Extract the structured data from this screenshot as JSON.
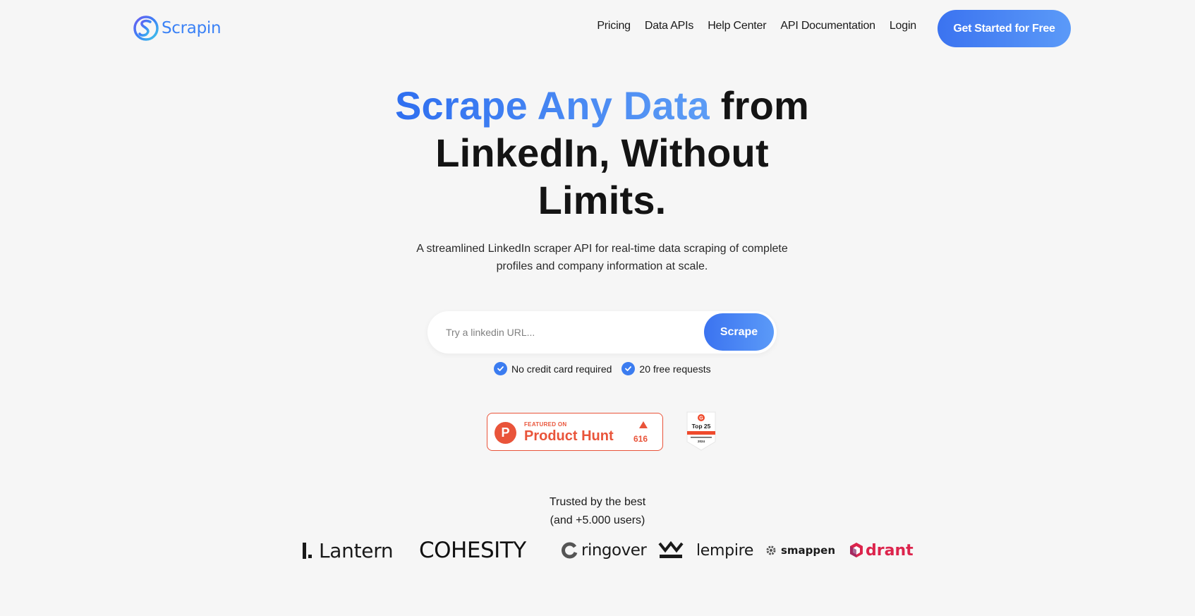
{
  "header": {
    "logo_text": "Scrapin",
    "nav": [
      "Pricing",
      "Data APIs",
      "Help Center",
      "API Documentation",
      "Login"
    ],
    "cta_label": "Get Started for Free"
  },
  "hero": {
    "title_accent": "Scrape Any Data",
    "title_rest_1": "from",
    "title_rest_2": "LinkedIn, Without",
    "title_rest_3": "Limits.",
    "subtitle_line1": "A streamlined LinkedIn scraper API for real-time data scraping of complete",
    "subtitle_line2": "profiles and company information at scale."
  },
  "search": {
    "placeholder": "Try a linkedin URL...",
    "value": "",
    "button_label": "Scrape"
  },
  "checks": [
    "No credit card required",
    "20 free requests"
  ],
  "badges": {
    "product_hunt_small": "FEATURED ON",
    "product_hunt_big": "Product Hunt",
    "product_hunt_count": "616",
    "g2_text": "Top 25",
    "g2_year": "2024"
  },
  "trusted": {
    "line1": "Trusted by the best",
    "line2": "(and +5.000 users)"
  },
  "logos": {
    "lantern": "Lantern",
    "cohesity": "COHESITY",
    "ringover": "ringover",
    "lempire": "lempire",
    "smappen": "smappen",
    "qdrant": "drant"
  },
  "colors": {
    "accent": "#3b82f6",
    "product_hunt": "#e9543a",
    "background": "#f6f6f6"
  }
}
